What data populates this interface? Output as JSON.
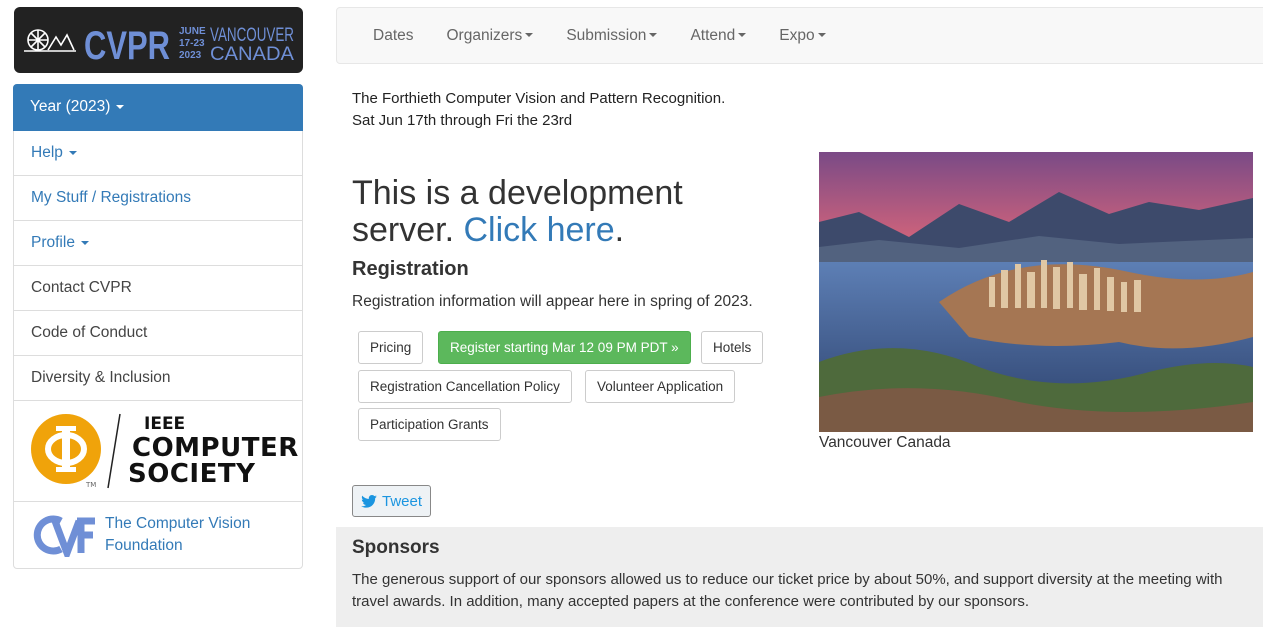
{
  "logo": {
    "name": "CVPR",
    "dates": [
      "JUNE",
      "17-23",
      "2023"
    ],
    "city": "VANCOUVER",
    "country": "CANADA"
  },
  "nav": {
    "items": [
      {
        "label": "Dates",
        "dropdown": false
      },
      {
        "label": "Organizers",
        "dropdown": true
      },
      {
        "label": "Submission",
        "dropdown": true
      },
      {
        "label": "Attend",
        "dropdown": true
      },
      {
        "label": "Expo",
        "dropdown": true
      }
    ]
  },
  "sidebar": {
    "items": [
      {
        "label": "Year (2023)",
        "dropdown": true
      },
      {
        "label": "Help",
        "dropdown": true
      },
      {
        "label": "My Stuff / Registrations",
        "dropdown": false
      },
      {
        "label": "Profile",
        "dropdown": true
      },
      {
        "label": "Contact CVPR",
        "dropdown": false
      },
      {
        "label": "Code of Conduct",
        "dropdown": false
      },
      {
        "label": "Diversity & Inclusion",
        "dropdown": false
      }
    ],
    "ieee": {
      "line1": "IEEE",
      "line2": "COMPUTER",
      "line3": "SOCIETY",
      "tm": "TM"
    },
    "cvf": {
      "line1": "The Computer Vision",
      "line2": "Foundation"
    }
  },
  "intro": {
    "line1": "The Forthieth Computer Vision and Pattern Recognition.",
    "line2": "Sat Jun 17th through Fri the 23rd"
  },
  "dev_notice": {
    "text": "This is a development server.",
    "link": "Click here",
    "end": "."
  },
  "registration": {
    "title": "Registration",
    "info": "Registration information will appear here in spring of 2023.",
    "buttons": {
      "pricing": "Pricing",
      "register": "Register starting Mar 12 09 PM PDT »",
      "hotels": "Hotels",
      "cancellation": "Registration Cancellation Policy",
      "volunteer": "Volunteer Application",
      "grants": "Participation Grants"
    }
  },
  "photo": {
    "caption": "Vancouver Canada"
  },
  "tweet": {
    "label": "Tweet"
  },
  "sponsors": {
    "title": "Sponsors",
    "text": "The generous support of our sponsors allowed us to reduce our ticket price by about 50%, and support diversity at the meeting with travel awards. In addition, many accepted papers at the conference were contributed by our sponsors."
  },
  "colors": {
    "link": "#337ab7",
    "active_bg": "#337ab7",
    "register_green": "#5cb85c",
    "logo_blue": "#6f8fd6",
    "logo_bg": "#222222",
    "ieee_orange": "#f0a30a",
    "twitter_blue": "#1b95e0"
  }
}
